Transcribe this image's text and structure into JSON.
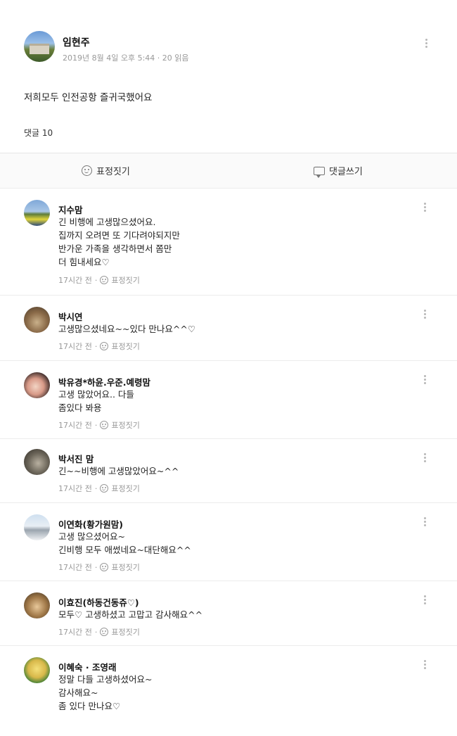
{
  "post": {
    "author": "임현주",
    "meta": "2019년 8월 4일 오후 5:44 · 20 읽음",
    "body": "저희모두 인전공항 즐귀국했어요",
    "comment_count": "댓글 10"
  },
  "actions": {
    "emoji_label": "표정짓기",
    "comment_label": "댓글쓰기"
  },
  "comments": [
    {
      "name": "지수맘",
      "lines": [
        "긴 비행에  고생많으셨어요.",
        "집까지 오려면 또 기다려야되지만",
        "반가운 가족을 생각하면서 쫌만",
        "더 힘내세요♡"
      ],
      "time": "17시간 전",
      "react": "표정짓기"
    },
    {
      "name": "박시연",
      "lines": [
        "고생많으셨네요~~있다 만나요^^♡"
      ],
      "time": "17시간 전",
      "react": "표정짓기"
    },
    {
      "name": "박유경*하윤.우준.예령맘",
      "lines": [
        "고생 많았어요.. 다들",
        "좀있다 봐용"
      ],
      "time": "17시간 전",
      "react": "표정짓기"
    },
    {
      "name": "박서진 맘",
      "lines": [
        "긴~~비행에 고생많았어요~^^"
      ],
      "time": "17시간 전",
      "react": "표정짓기"
    },
    {
      "name": "이연화(황가원맘)",
      "lines": [
        "고생 많으셨어요~",
        "긴비행 모두 애썼네요~대단해요^^"
      ],
      "time": "17시간 전",
      "react": "표정짓기"
    },
    {
      "name": "이효진(하동건동쥬♡)",
      "lines": [
        "모두♡ 고생하셨고 고맙고 감사해요^^"
      ],
      "time": "17시간 전",
      "react": "표정짓기"
    },
    {
      "name": "이혜숙 · 조영래",
      "lines": [
        "정말 다들 고생하셨어요~",
        "감사해요~",
        "좀 있다 만나요♡"
      ],
      "time": "",
      "react": ""
    }
  ],
  "colors": {
    "text": "#222222",
    "meta": "#999999",
    "divider": "#ececec"
  }
}
